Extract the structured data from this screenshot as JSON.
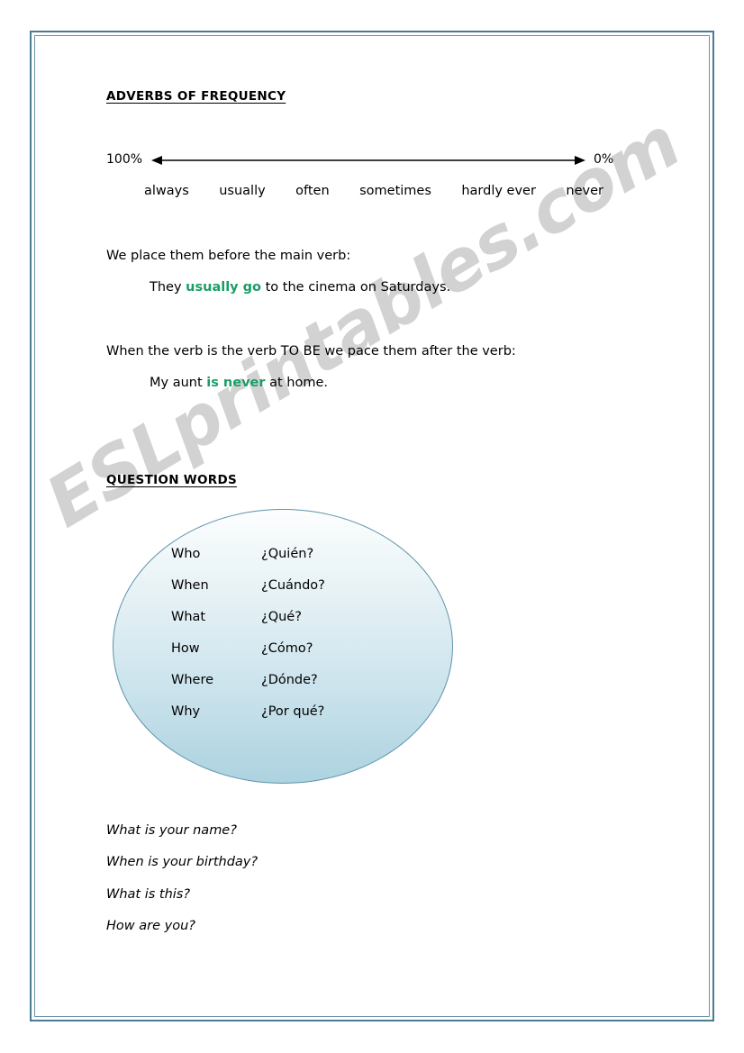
{
  "document": {
    "border_color": "#4a7b93",
    "watermark": "ESLprintables.com",
    "watermark_color": "#d2d2d2",
    "highlight_color": "#1a9e66"
  },
  "sections": {
    "adverbs": {
      "heading": "ADVERBS OF FREQUENCY",
      "scale": {
        "left_label": "100%",
        "right_label": "0%",
        "adverbs": [
          "always",
          "usually",
          "often",
          "sometimes",
          "hardly ever",
          "never"
        ]
      },
      "rule_1": "We place them before the main verb:",
      "example_1": {
        "before": "They ",
        "highlight": "usually go",
        "after": " to the cinema on Saturdays."
      },
      "rule_2": "When the verb is the verb TO BE we pace them after the verb:",
      "example_2": {
        "before": "My aunt ",
        "highlight": "is never",
        "after": " at home."
      }
    },
    "question_words": {
      "heading": "QUESTION WORDS",
      "pairs": [
        {
          "english": "Who",
          "spanish": "¿Quién?"
        },
        {
          "english": "When",
          "spanish": "¿Cuándo?"
        },
        {
          "english": "What",
          "spanish": "¿Qué?"
        },
        {
          "english": "How",
          "spanish": "¿Cómo?"
        },
        {
          "english": "Where",
          "spanish": "¿Dónde?"
        },
        {
          "english": "Why",
          "spanish": "¿Por qué?"
        }
      ],
      "examples": [
        "What is your name?",
        "When is your birthday?",
        "What is this?",
        "How are you?"
      ]
    }
  }
}
